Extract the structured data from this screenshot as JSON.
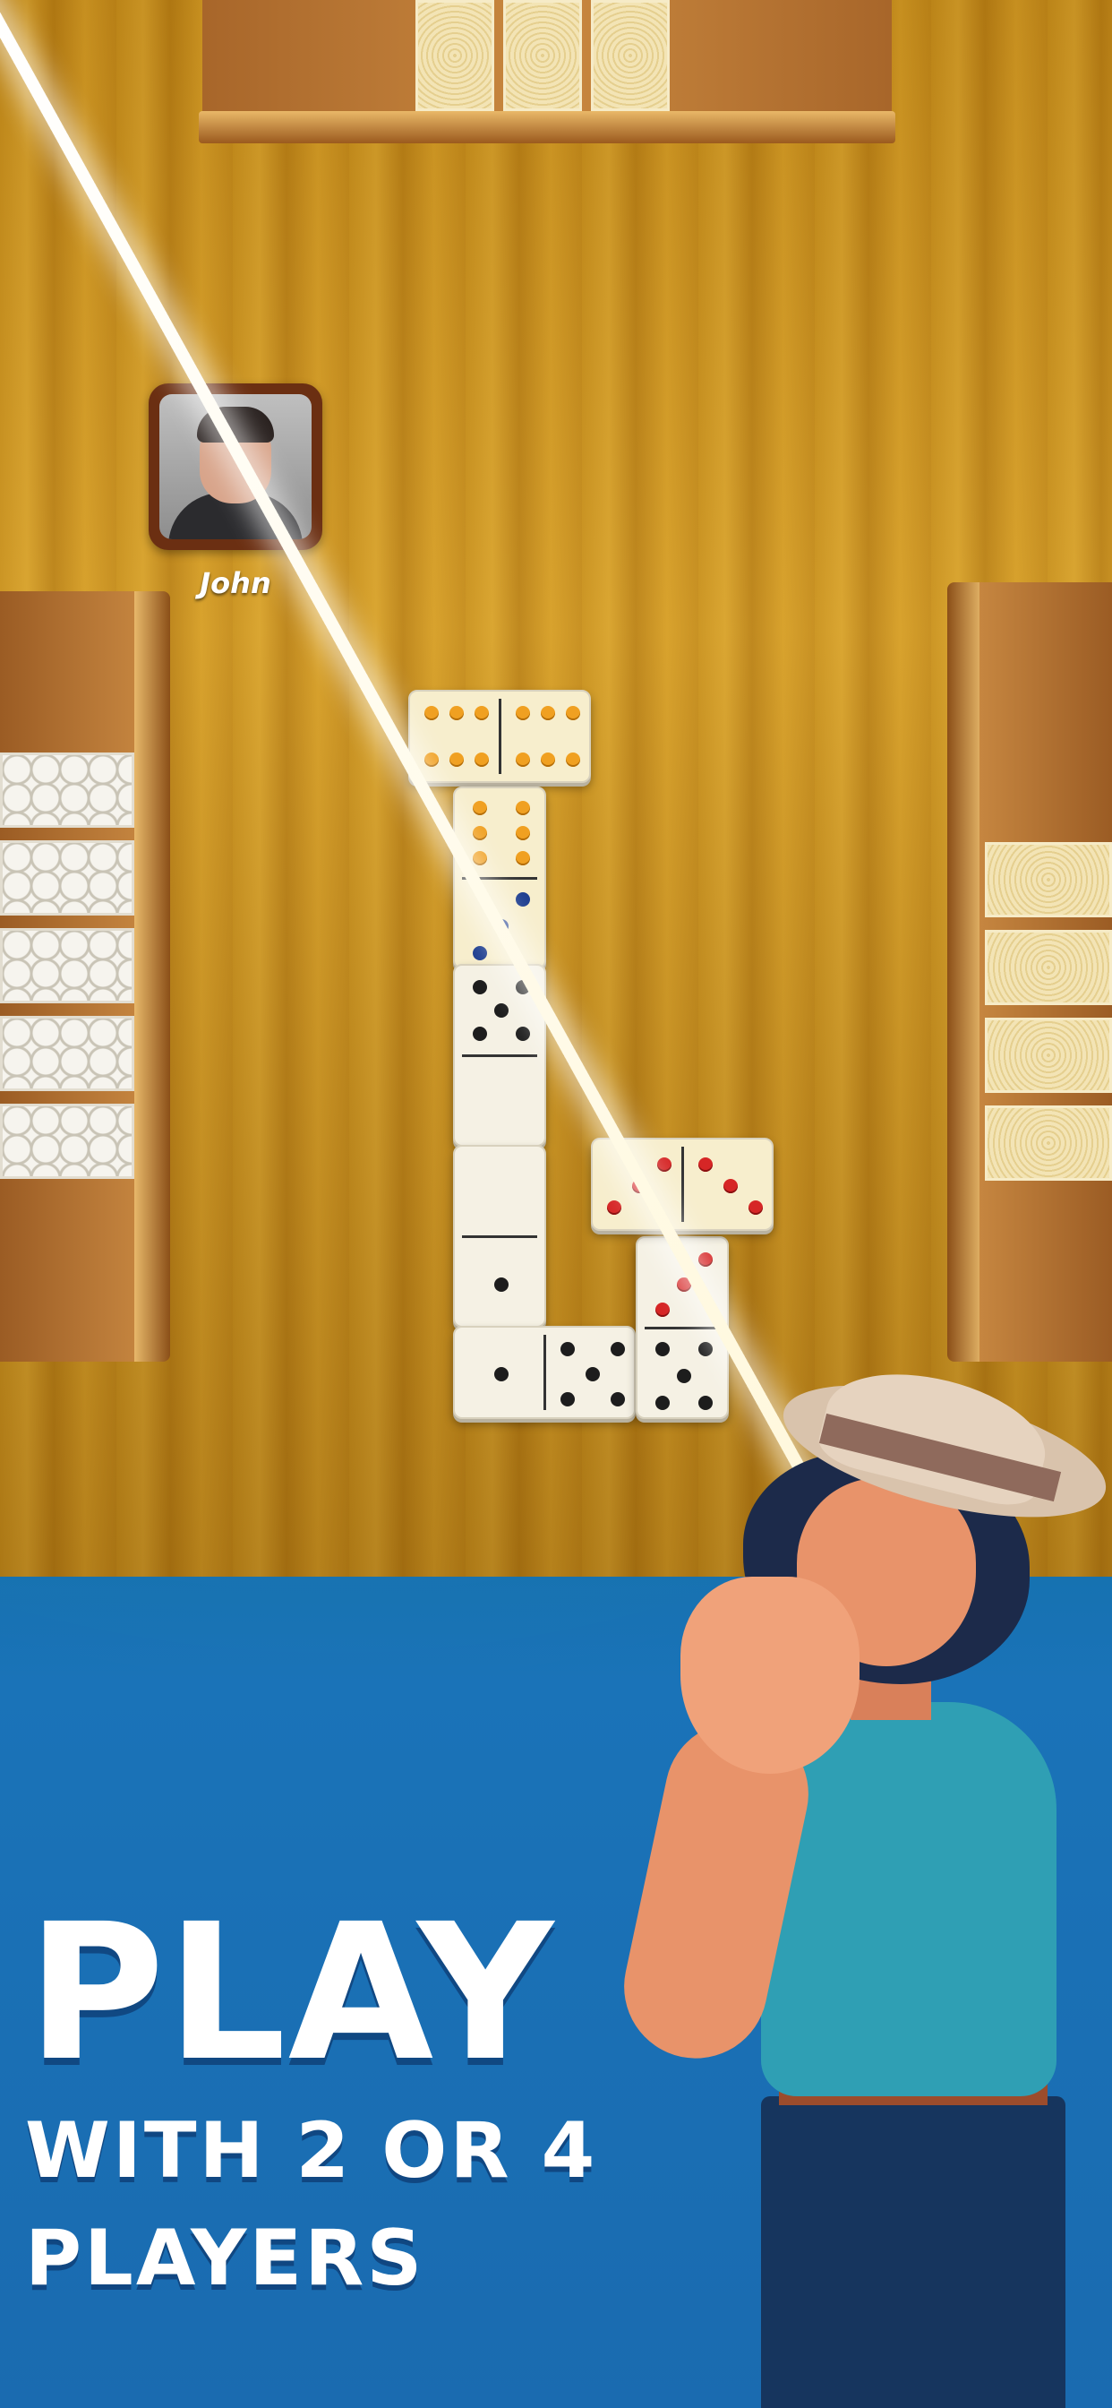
{
  "player": {
    "name": "John"
  },
  "caption": {
    "headline": "PLAY",
    "line1": "WITH 2 OR 4",
    "line2": "PLAYERS"
  },
  "colors": {
    "felt": "#167a3c",
    "wood": "#c78f1c",
    "sky": "#1a73b8"
  },
  "icons": [
    "player-avatar",
    "domino-tile",
    "character-illustration"
  ]
}
